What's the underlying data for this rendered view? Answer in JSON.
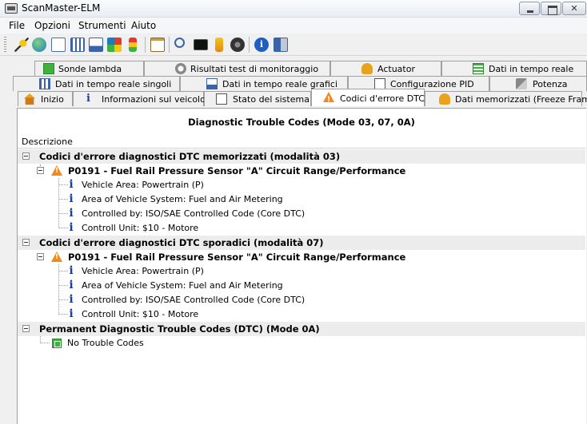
{
  "window": {
    "title": "ScanMaster-ELM"
  },
  "menu": [
    "File",
    "Opzioni",
    "Strumenti",
    "Aiuto"
  ],
  "toolbar": {
    "icons": [
      "connect-icon",
      "globe-icon",
      "document-icon",
      "grid-icon",
      "chart-icon",
      "graph-icon",
      "traffic-light-icon",
      "clipboard-icon",
      "search-icon",
      "terminal-icon",
      "fuel-icon",
      "gauge-icon",
      "info-icon",
      "exit-icon"
    ]
  },
  "tabs": {
    "row1": [
      "Sonde lambda",
      "Risultati test di monitoraggio",
      "Actuator",
      "Dati in tempo reale"
    ],
    "row2": [
      "Dati in tempo reale singoli",
      "Dati in tempo reale grafici",
      "Configurazione PID",
      "Potenza"
    ],
    "row3": [
      "Inizio",
      "Informazioni sul veicolo",
      "Stato del sistema",
      "Codici d'errore DTC",
      "Dati memorizzati (Freeze Frame)"
    ]
  },
  "panel": {
    "title": "Diagnostic Trouble Codes (Mode 03, 07, 0A)",
    "column_header": "Descrizione",
    "sections": [
      {
        "title": "Codici d'errore diagnostici DTC memorizzati (modalità 03)",
        "dtc": "P0191 - Fuel Rail Pressure Sensor \"A\" Circuit Range/Performance",
        "details": [
          "Vehicle Area: Powertrain (P)",
          "Area of Vehicle System: Fuel and Air Metering",
          "Controlled by: ISO/SAE Controlled Code (Core DTC)",
          "Controll Unit: $10 - Motore"
        ]
      },
      {
        "title": "Codici d'errore diagnostici DTC sporadici (modalità 07)",
        "dtc": "P0191 - Fuel Rail Pressure Sensor \"A\" Circuit Range/Performance",
        "details": [
          "Vehicle Area: Powertrain (P)",
          "Area of Vehicle System: Fuel and Air Metering",
          "Controlled by: ISO/SAE Controlled Code (Core DTC)",
          "Controll Unit: $10 - Motore"
        ]
      },
      {
        "title": "Permanent Diagnostic Trouble Codes (DTC) (Mode 0A)",
        "no_codes": "No Trouble Codes"
      }
    ]
  },
  "colors": {
    "section_bg": "#ececec",
    "warning": "#f08a1c",
    "info": "#1c3f94",
    "ok": "#3fb13f"
  }
}
